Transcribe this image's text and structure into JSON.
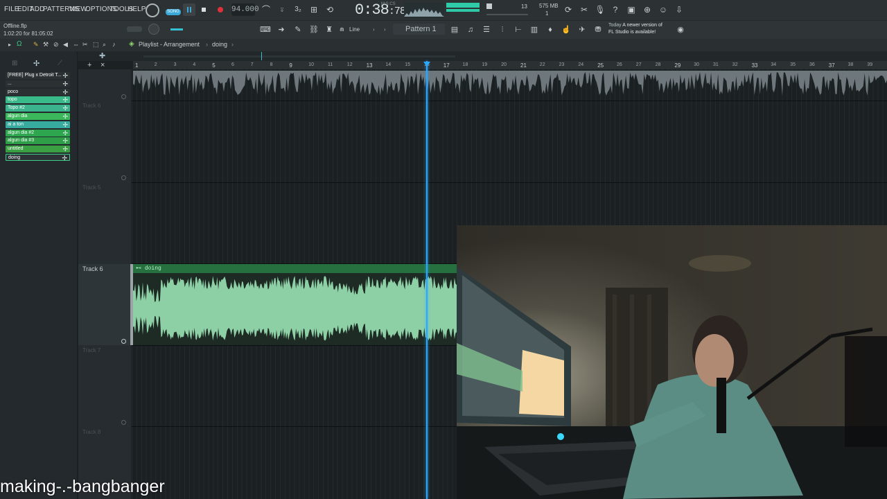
{
  "menu": {
    "file": "FILE",
    "edit": "EDIT",
    "add": "ADD",
    "patterns": "PATTERNS",
    "view": "VIEW",
    "options": "OPTIONS",
    "tools": "TOOLS",
    "help": "HELP"
  },
  "transport": {
    "mode": "SONG",
    "tempo": "94.000",
    "time_main": "0:38",
    "time_sub": "78",
    "time_unit": "M:S:CS",
    "memory": "575 MB",
    "cpu_top": "13",
    "cpu_bottom": "1"
  },
  "toolbar2": {
    "snap": "Line",
    "pattern": "Pattern 1",
    "notice_today": "Today",
    "notice_text_1": "A newer version of",
    "notice_text_2": "FL Studio is available!"
  },
  "project": {
    "file": "Offline.flp",
    "position": "1:02:20 for 81:05:02"
  },
  "playlist": {
    "crumb_title": "Playlist - Arrangement",
    "crumb_sep": "›",
    "crumb_pattern": "doing"
  },
  "browser": {
    "items": [
      {
        "label": "[FREE] Plug x Detroit T...",
        "color": "#2b3033"
      },
      {
        "label": "...",
        "color": "#2b3033"
      },
      {
        "label": "poco",
        "color": "#2b3033"
      },
      {
        "label": "topo",
        "color": "#3ab98a"
      },
      {
        "label": "Topo #2",
        "color": "#3bb38d"
      },
      {
        "label": "algun dia",
        "color": "#3cb85c"
      },
      {
        "label": "ai a ton",
        "color": "#37ac9e"
      },
      {
        "label": "algun dia #2",
        "color": "#2ea650"
      },
      {
        "label": "algun dia #3",
        "color": "#2f9e48"
      },
      {
        "label": "untitled",
        "color": "#3a9e43"
      },
      {
        "label": "doing",
        "color": "#2c3235"
      }
    ]
  },
  "tracks": [
    {
      "name": "Track 6"
    },
    {
      "name": "Track 5"
    },
    {
      "name": "Track 6"
    },
    {
      "name": "Track 7"
    },
    {
      "name": "Track 8"
    }
  ],
  "ruler": {
    "marks": [
      "1",
      "2",
      "3",
      "4",
      "5",
      "6",
      "7",
      "8",
      "9",
      "10",
      "11",
      "12",
      "13",
      "14",
      "15",
      "16",
      "17",
      "18",
      "19",
      "20",
      "21",
      "22",
      "23",
      "24",
      "25",
      "26",
      "27",
      "28",
      "29",
      "30",
      "31",
      "32",
      "33",
      "34",
      "35",
      "36",
      "37",
      "38",
      "39"
    ],
    "playhead_bar": 16
  },
  "clip": {
    "name": "doing"
  },
  "icons": {
    "record": "record-icon",
    "play": "pause-icon",
    "stop": "stop-icon",
    "metronome": "metronome-icon",
    "settings": "gear-icon"
  },
  "colors": {
    "clip_wave": "#8ed0a6",
    "clip_header": "#26703f",
    "playhead": "#2aa7ff",
    "record": "#e0313a"
  },
  "caption": "making-.-bangbanger"
}
